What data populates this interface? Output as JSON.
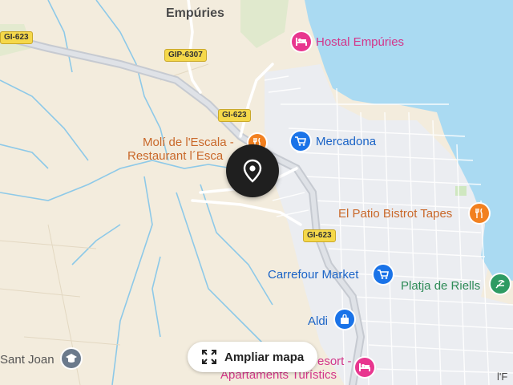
{
  "map": {
    "places": {
      "empories": "Empúries",
      "sant_joan": "Sant Joan",
      "edge_fragment": "l'F"
    },
    "roads": {
      "gi623_west": "GI-623",
      "gip6307": "GIP-6307",
      "gi623_north": "GI-623",
      "gi623_south": "GI-623"
    },
    "pois": {
      "hostal": "Hostal Empúries",
      "mercadona": "Mercadona",
      "moli_line1": "Molí de l'Escala -",
      "moli_line2": "Restaurant l´Esca",
      "patio": "El Patio Bistrot Tapes",
      "carrefour": "Carrefour Market",
      "platja": "Platja de Riells",
      "aldi": "Aldi",
      "resort_line1": "esort -",
      "resort_line2": "Apartaments Turístics"
    },
    "colors": {
      "sea": "#aadaf2",
      "land": "#f5efe2",
      "town": "#eceff3",
      "shop": "#1a73e8",
      "food": "#f2801f",
      "hotel": "#e8368f",
      "beach": "#2e9b63",
      "school": "#6b7a8c"
    }
  },
  "controls": {
    "expand_label": "Ampliar mapa"
  }
}
